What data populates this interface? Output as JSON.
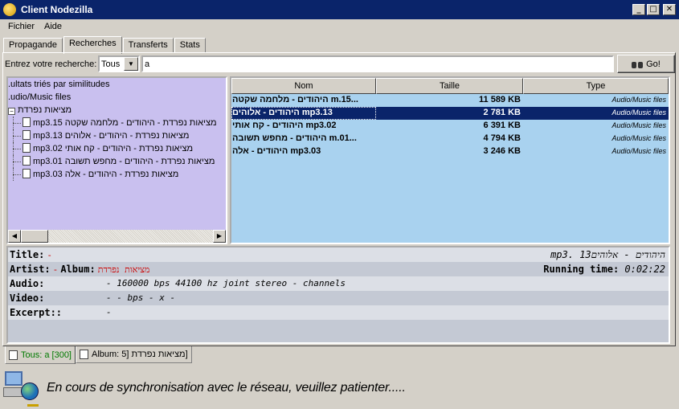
{
  "window": {
    "title": "Client Nodezilla",
    "btn_min": "_",
    "btn_max": "□",
    "btn_close": "✕"
  },
  "menu": [
    "Fichier",
    "Aide"
  ],
  "tabs": [
    "Propagande",
    "Recherches",
    "Transferts",
    "Stats"
  ],
  "search": {
    "label": "Entrez votre recherche:",
    "scope": "Tous",
    "query": "a",
    "go_label": "Go!"
  },
  "tree": {
    "root": ".ultats triés par similitudes",
    "category": ".udio/Music files",
    "folder": "מציאות נפרדת",
    "items": [
      "mp3.15 מציאות נפרדת - היהודים - מלחמה שקטה",
      "mp3.13 מציאות נפרדת - היהודים - אלוהים",
      "mp3.02 מציאות נפרדת - היהודים - קח אותי",
      "mp3.01 מציאות נפרדת - היהודים - מחפש תשובה",
      "mp3.03 מציאות נפרדת - היהודים - אלה"
    ]
  },
  "results": {
    "columns": [
      "Nom",
      "Taille",
      "Type"
    ],
    "rows": [
      {
        "name": "היהודים - מלחמה שקטה m.15...",
        "size": "11 589 KB",
        "type": "Audio/Music files"
      },
      {
        "name": "היהודים - אלוהים mp3.13",
        "size": "2 781 KB",
        "type": "Audio/Music files"
      },
      {
        "name": "היהודים - קח אותי mp3.02",
        "size": "6 391 KB",
        "type": "Audio/Music files"
      },
      {
        "name": "היהודים - מחפש תשובה m.01...",
        "size": "4 794 KB",
        "type": "Audio/Music files"
      },
      {
        "name": "היהודים - אלה mp3.03",
        "size": "3 246 KB",
        "type": "Audio/Music files"
      }
    ]
  },
  "details": {
    "title_label": "Title:",
    "title_value": "-",
    "title_right": "mp3. היהודים - אלוהים13",
    "artist_label": "Artist:",
    "artist_value": "-",
    "album_label": "Album:",
    "album_value": "מציאות נפרדת",
    "running_label": "Running time:",
    "running_value": "0:02:22",
    "audio_label": "Audio:",
    "audio_value": "- 160000 bps 44100 hz joint stereo - channels",
    "video_label": "Video:",
    "video_value": "- - bps - x -",
    "excerpt_label": "Excerpt::",
    "excerpt_value": "-"
  },
  "bottom_tabs": [
    "Tous: a [300]",
    "Album: 5] מציאות נפרדת]"
  ],
  "status": {
    "message": "En cours de synchronisation avec le réseau, veuillez patienter....."
  }
}
